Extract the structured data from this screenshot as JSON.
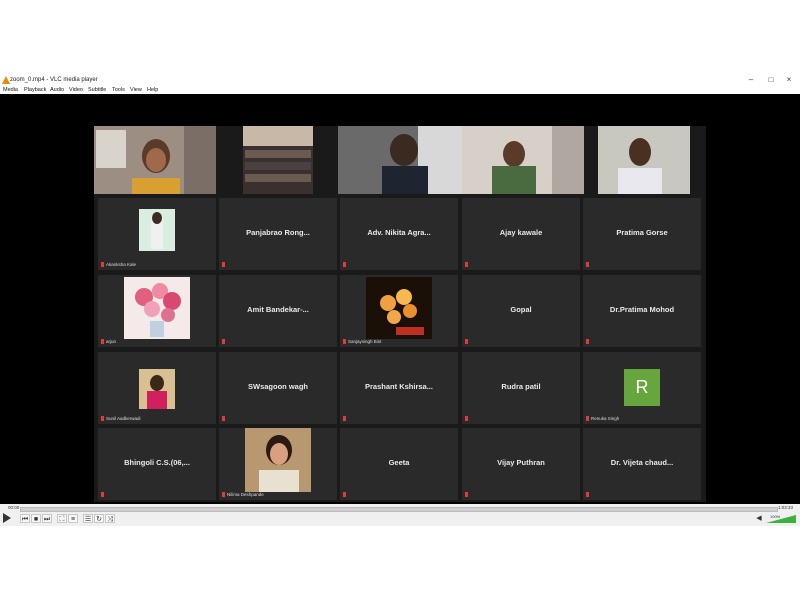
{
  "window": {
    "title": "zoom_0.mp4 - VLC media player",
    "controls": {
      "minimize": "–",
      "maximize": "□",
      "close": "×"
    }
  },
  "menu": [
    "Media",
    "Playback",
    "Audio",
    "Video",
    "Subtitle",
    "Tools",
    "View",
    "Help"
  ],
  "tiles_row1": [
    {
      "label": ""
    },
    {
      "label": ""
    },
    {
      "label": ""
    },
    {
      "label": ""
    },
    {
      "label": ""
    }
  ],
  "participants": {
    "r2c1": {
      "label": "Akanksha Kale"
    },
    "r2c2": {
      "name": "Panjabrao  Rong..."
    },
    "r2c3": {
      "name": "Adv. Nikita Agra..."
    },
    "r2c4": {
      "name": "Ajay kawale"
    },
    "r2c5": {
      "name": "Pratima Gorse"
    },
    "r3c1": {
      "label": "arjun"
    },
    "r3c2": {
      "name": "Amit Bandekar-..."
    },
    "r3c3": {
      "label": "Sanjaysingh Bist"
    },
    "r3c4": {
      "name": "Gopal"
    },
    "r3c5": {
      "name": "Dr.Pratima Mohod"
    },
    "r4c1": {
      "label": "Sunil Aadkerwadi"
    },
    "r4c2": {
      "name": "SWsagoon wagh"
    },
    "r4c3": {
      "name": "Prashant  Kshirsa..."
    },
    "r4c4": {
      "name": "Rudra patil"
    },
    "r4c5": {
      "label": "Renuka Singh",
      "avatar_letter": "R"
    },
    "r5c1": {
      "name": "Bhingoli  C.S.(06,..."
    },
    "r5c2": {
      "label": "Nilima Deshpande"
    },
    "r5c3": {
      "name": "Geeta"
    },
    "r5c4": {
      "name": "Vijay Puthran"
    },
    "r5c5": {
      "name": "Dr. Vijeta  chaud..."
    }
  },
  "player": {
    "time_elapsed": "00:00",
    "time_total": "1:03:33",
    "volume_label": "100%",
    "progress": 0.0
  },
  "colors": {
    "accent": "#f08a00",
    "avatar": "#67a53d",
    "mic_muted": "#e03b3b",
    "volume": "#3cb13c"
  }
}
